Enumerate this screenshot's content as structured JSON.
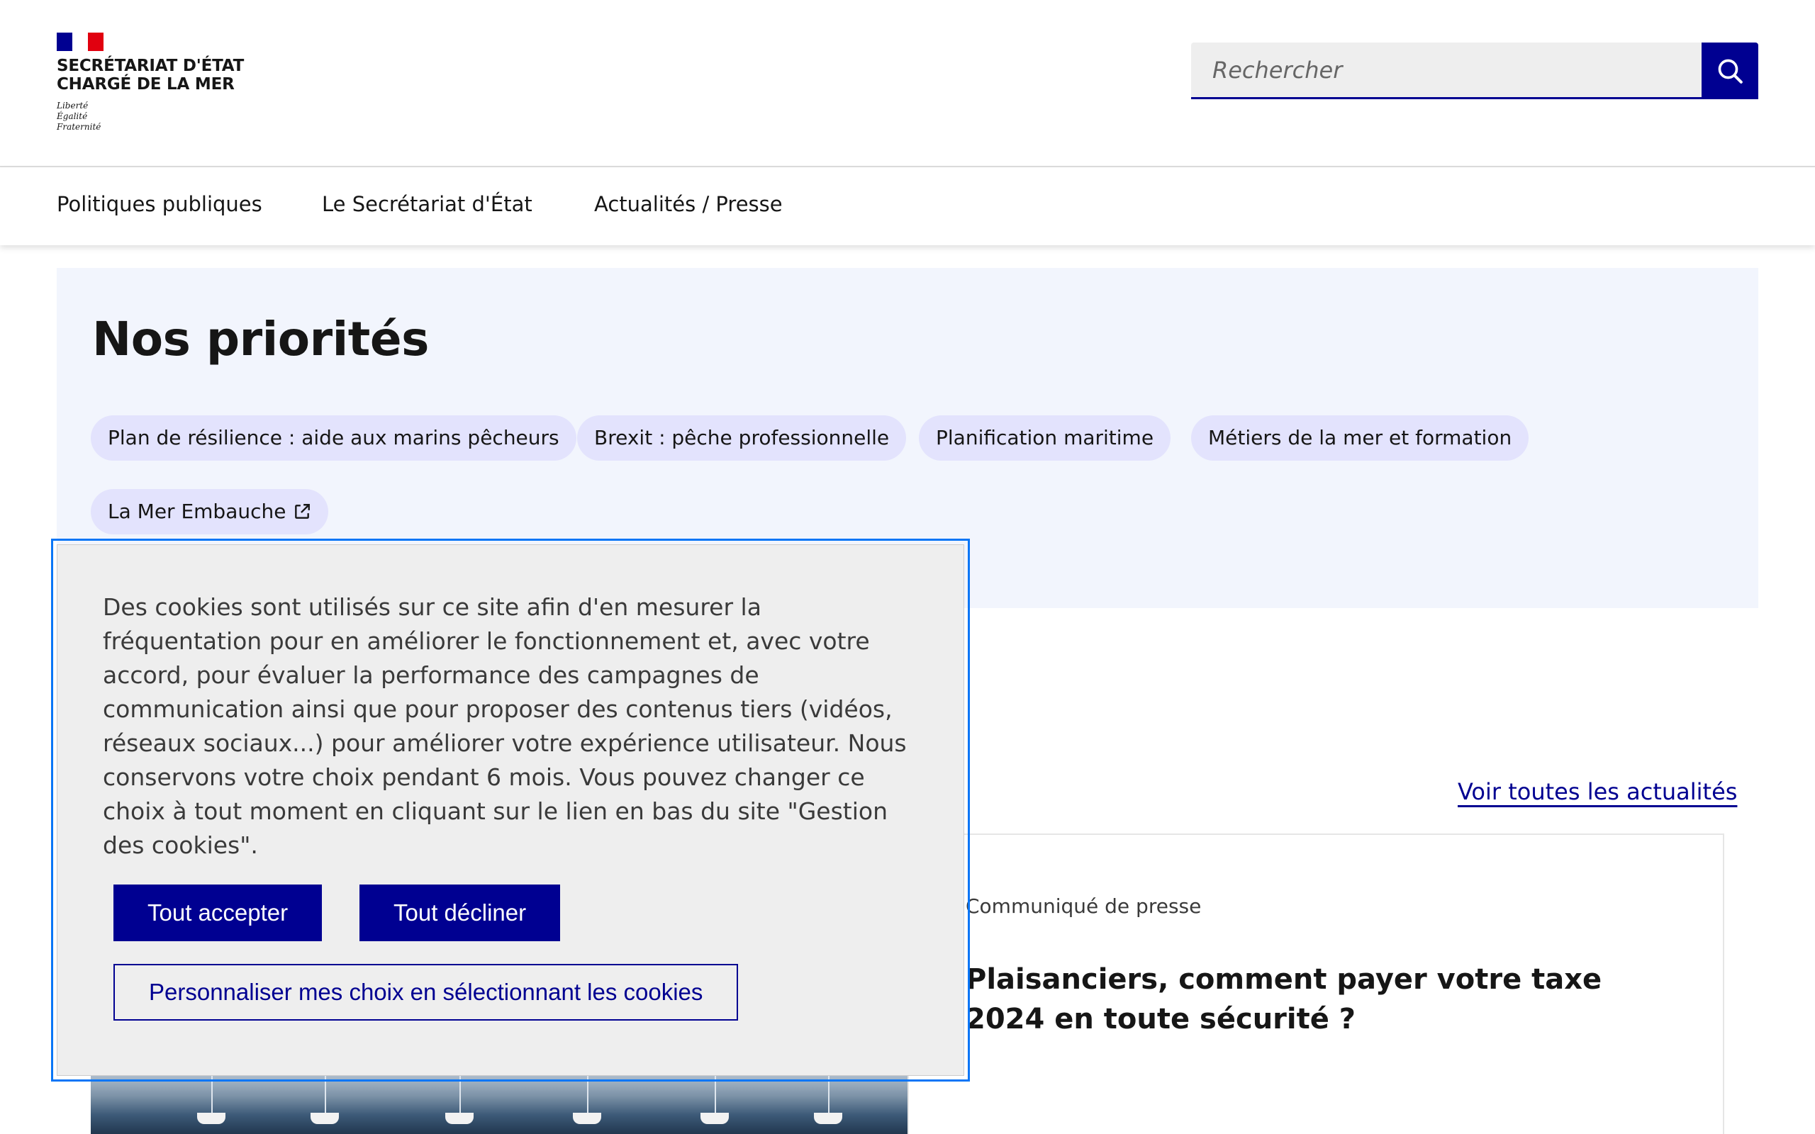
{
  "header": {
    "flag_colors": [
      "#000091",
      "#ffffff",
      "#e1000f"
    ],
    "logo_title": "Secrétariat d'État\nchargé de la mer",
    "motto": "Liberté\nÉgalité\nFraternité",
    "search_placeholder": "Rechercher",
    "search_icon": "search-icon"
  },
  "nav": {
    "items": [
      {
        "label": "Politiques publiques"
      },
      {
        "label": "Le Secrétariat d'État"
      },
      {
        "label": "Actualités / Presse"
      }
    ]
  },
  "priorities": {
    "title": "Nos priorités",
    "tags": [
      {
        "label": "Plan de résilience : aide aux marins pêcheurs"
      },
      {
        "label": "Brexit : pêche professionnelle"
      },
      {
        "label": "Planification maritime"
      },
      {
        "label": "Métiers de la mer et formation"
      },
      {
        "label": "La Mer Embauche",
        "icon": "external-link-icon"
      }
    ]
  },
  "news": {
    "see_all_label": "Voir toutes les actualités",
    "card": {
      "kicker": "Communiqué de presse",
      "title": "Plaisanciers, comment payer votre taxe 2024 en toute sécurité ?"
    }
  },
  "cookie_banner": {
    "text": "Des cookies sont utilisés sur ce site afin d'en mesurer la fréquentation pour en améliorer le fonctionnement et, avec votre accord, pour évaluer la performance des campagnes de communication ainsi que pour proposer des contenus tiers (vidéos, réseaux sociaux...) pour améliorer votre expérience utilisateur. Nous conservons votre choix pendant 6 mois. Vous pouvez changer ce choix à tout moment en cliquant sur le lien en bas du site \"Gestion des cookies\".",
    "accept_label": "Tout accepter",
    "decline_label": "Tout décliner",
    "customize_label": "Personnaliser mes choix en sélectionnant les cookies"
  },
  "colors": {
    "primary": "#000091",
    "tag_bg": "#e3e3fd",
    "section_bg": "#f2f5fd",
    "focus_outline": "#0a76f6"
  }
}
